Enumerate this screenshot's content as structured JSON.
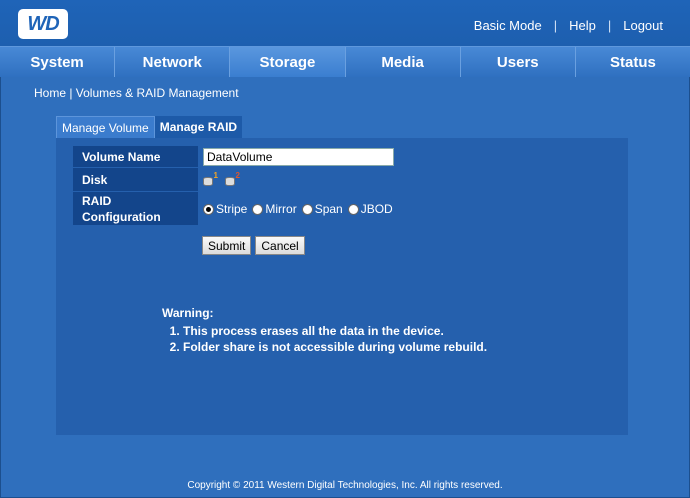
{
  "brand": {
    "logo_text": "WD"
  },
  "top_links": {
    "basic_mode": "Basic Mode",
    "sep": "|",
    "help": "Help",
    "logout": "Logout"
  },
  "nav": {
    "tabs": [
      {
        "label": "System"
      },
      {
        "label": "Network"
      },
      {
        "label": "Storage"
      },
      {
        "label": "Media"
      },
      {
        "label": "Users"
      },
      {
        "label": "Status"
      }
    ],
    "active": "Storage"
  },
  "breadcrumb": "Home | Volumes & RAID Management",
  "subtabs": {
    "manage_volume": "Manage Volume",
    "manage_raid": "Manage RAID"
  },
  "form": {
    "volume_name_label": "Volume Name",
    "volume_name_value": "DataVolume",
    "disk_label": "Disk",
    "disk1_num": "1",
    "disk2_num": "2",
    "raid_label_line1": "RAID",
    "raid_label_line2": "Configuration",
    "raid_options": {
      "stripe": "Stripe",
      "mirror": "Mirror",
      "span": "Span",
      "jbod": "JBOD"
    },
    "raid_selected": "Stripe",
    "submit": "Submit",
    "cancel": "Cancel"
  },
  "warning": {
    "title": "Warning:",
    "items": [
      "This process erases all the data in the device.",
      "Folder share is not accessible during volume rebuild."
    ]
  },
  "footer": "Copyright © 2011 Western Digital Technologies, Inc. All rights reserved.",
  "colors": {
    "background": "#2f6fbd",
    "panel": "#2560ad",
    "label_bg": "#13458b"
  }
}
